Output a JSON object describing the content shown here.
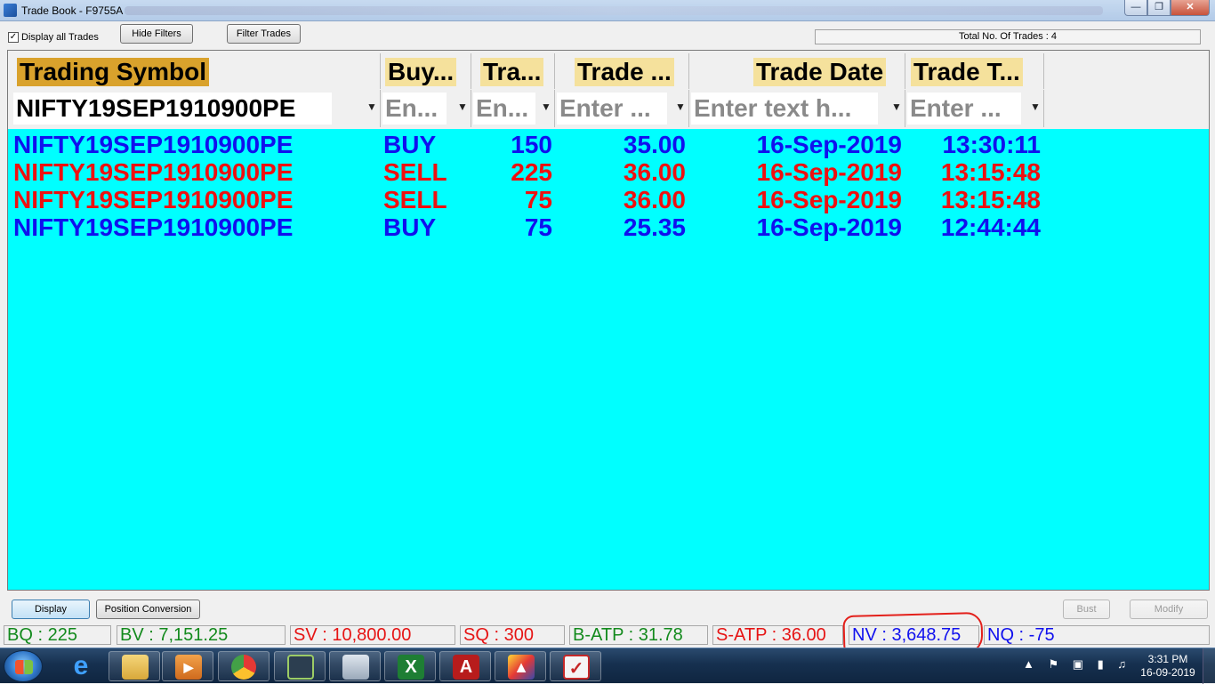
{
  "window": {
    "title": "Trade Book - F9755A",
    "controls": {
      "minimize": "—",
      "maximize": "❐",
      "close": "✕"
    }
  },
  "toolbar": {
    "display_all_label": "Display all Trades",
    "display_all_checked": "✓",
    "hide_filters_label": "Hide Filters",
    "filter_trades_label": "Filter Trades",
    "total_trades": "Total No. Of Trades : 4"
  },
  "grid": {
    "columns": [
      "Trading Symbol",
      "Buy...",
      "Tra...",
      "Trade ...",
      "Trade Date",
      "Trade T..."
    ],
    "filters": [
      "NIFTY19SEP1910900PE",
      "En...",
      "En...",
      "Enter ...",
      "Enter text h...",
      "Enter ..."
    ],
    "filter_icon": "▼",
    "rows": [
      {
        "symbol": "NIFTY19SEP1910900PE",
        "side": "BUY",
        "qty": "150",
        "price": "35.00",
        "date": "16-Sep-2019",
        "time": "13:30:11"
      },
      {
        "symbol": "NIFTY19SEP1910900PE",
        "side": "SELL",
        "qty": "225",
        "price": "36.00",
        "date": "16-Sep-2019",
        "time": "13:15:48"
      },
      {
        "symbol": "NIFTY19SEP1910900PE",
        "side": "SELL",
        "qty": "75",
        "price": "36.00",
        "date": "16-Sep-2019",
        "time": "13:15:48"
      },
      {
        "symbol": "NIFTY19SEP1910900PE",
        "side": "BUY",
        "qty": "75",
        "price": "25.35",
        "date": "16-Sep-2019",
        "time": "12:44:44"
      }
    ]
  },
  "bottom": {
    "display_label": "Display",
    "position_conversion_label": "Position Conversion",
    "bust_label": "Bust",
    "modify_label": "Modify"
  },
  "status": {
    "bq": "BQ : 225",
    "bv": "BV : 7,151.25",
    "sv": "SV : 10,800.00",
    "sq": "SQ : 300",
    "batp": "B-ATP : 31.78",
    "satp": "S-ATP : 36.00",
    "nv": "NV : 3,648.75",
    "nq": "NQ : -75"
  },
  "taskbar": {
    "time": "3:31 PM",
    "date": "16-09-2019",
    "icons": [
      "start-orb",
      "ie-icon",
      "file-explorer-icon",
      "media-player-icon",
      "chrome-icon",
      "trading-app-icon",
      "calculator-icon",
      "excel-icon",
      "acrobat-icon",
      "app-a-icon",
      "app-box-icon"
    ]
  },
  "colors": {
    "grid_bg": "#00ffff",
    "buy": "#1010ee",
    "sell": "#ee1010",
    "header_first": "#d9a22c",
    "header": "#f5e19c",
    "status_green": "#138a1d",
    "annotation": "#e3201b"
  }
}
